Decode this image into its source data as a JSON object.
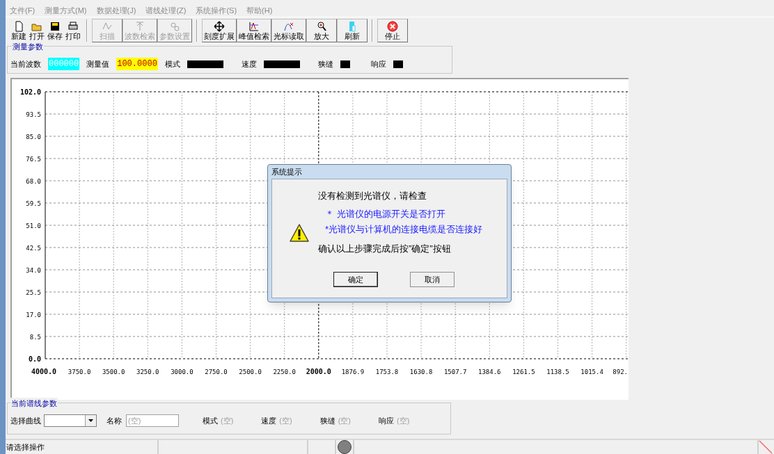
{
  "menu": [
    {
      "label": "文件(F)"
    },
    {
      "label": "测量方式(M)"
    },
    {
      "label": "数据处理(J)"
    },
    {
      "label": "谱线处理(Z)"
    },
    {
      "label": "系统操作(S)"
    },
    {
      "label": "帮助(H)"
    }
  ],
  "toolbar_groups": [
    {
      "kind": "flat",
      "buttons": [
        {
          "label": "新建",
          "disabled": false
        },
        {
          "label": "打开",
          "disabled": false
        },
        {
          "label": "保存",
          "disabled": false
        },
        {
          "label": "打印",
          "disabled": false
        }
      ]
    },
    {
      "kind": "framed",
      "buttons": [
        {
          "label": "扫描",
          "disabled": true
        },
        {
          "label": "波数检索",
          "disabled": true
        },
        {
          "label": "参数设置",
          "disabled": true
        }
      ]
    },
    {
      "kind": "framed",
      "buttons": [
        {
          "label": "刻度扩展",
          "disabled": false
        },
        {
          "label": "峰值检索",
          "disabled": false
        },
        {
          "label": "光标读取",
          "disabled": false
        },
        {
          "label": "放大",
          "disabled": false
        },
        {
          "label": "刷新",
          "disabled": false
        }
      ]
    },
    {
      "kind": "framed",
      "buttons": [
        {
          "label": "停止",
          "disabled": false
        }
      ]
    }
  ],
  "measurement": {
    "title": "测量参数",
    "fields": [
      {
        "label": "当前波数",
        "value": "000000",
        "color": "#00ffff"
      },
      {
        "label": "测量值",
        "value": "100.0000",
        "color": "#ffff00"
      },
      {
        "label": "模式"
      },
      {
        "label": "速度"
      },
      {
        "label": "狭缝"
      },
      {
        "label": "响应"
      }
    ]
  },
  "chart": {
    "y_labels": [
      {
        "text": "102.0",
        "bold": true
      },
      {
        "text": "93.5",
        "bold": false
      },
      {
        "text": "85.0",
        "bold": false
      },
      {
        "text": "76.5",
        "bold": false
      },
      {
        "text": "68.0",
        "bold": false
      },
      {
        "text": "59.5",
        "bold": false
      },
      {
        "text": "51.0",
        "bold": false
      },
      {
        "text": "42.5",
        "bold": false
      },
      {
        "text": "34.0",
        "bold": false
      },
      {
        "text": "25.5",
        "bold": false
      },
      {
        "text": "17.0",
        "bold": false
      },
      {
        "text": "8.5",
        "bold": false
      },
      {
        "text": "0.0",
        "bold": true
      }
    ],
    "x_labels": [
      {
        "text": "4000.0",
        "bold": true
      },
      {
        "text": "3750.0",
        "bold": false
      },
      {
        "text": "3500.0",
        "bold": false
      },
      {
        "text": "3250.0",
        "bold": false
      },
      {
        "text": "3000.0",
        "bold": false
      },
      {
        "text": "2750.0",
        "bold": false
      },
      {
        "text": "2500.0",
        "bold": false
      },
      {
        "text": "2250.0",
        "bold": false
      },
      {
        "text": "2000.0",
        "bold": true
      },
      {
        "text": "1876.9",
        "bold": false
      },
      {
        "text": "1753.8",
        "bold": false
      },
      {
        "text": "1630.8",
        "bold": false
      },
      {
        "text": "1507.7",
        "bold": false
      },
      {
        "text": "1384.6",
        "bold": false
      },
      {
        "text": "1261.5",
        "bold": false
      },
      {
        "text": "1138.5",
        "bold": false
      },
      {
        "text": "1015.4",
        "bold": false
      },
      {
        "text": "892.",
        "bold": false
      }
    ]
  },
  "dialog": {
    "title": "系统提示",
    "message": "没有检测到光谱仪，请检查",
    "hints": [
      "＊ 光谱仪的电源开关是否打开",
      "*光谱仪与计算机的连接电缆是否连接好"
    ],
    "instruction": "确认以上步骤完成后按”确定”按钮",
    "buttons": [
      {
        "label": "确定",
        "focused": true
      },
      {
        "label": "取消",
        "focused": false
      }
    ]
  },
  "curve_params": {
    "title": "当前谱线参数",
    "select_label": "选择曲线",
    "name_label": "名称",
    "name_value": "(空)",
    "fields": [
      {
        "label": "模式",
        "value": "(空)"
      },
      {
        "label": "速度",
        "value": "(空)"
      },
      {
        "label": "狭缝",
        "value": "(空)"
      },
      {
        "label": "响应",
        "value": "(空)"
      }
    ]
  },
  "status_bar": {
    "text": "请选择操作"
  }
}
